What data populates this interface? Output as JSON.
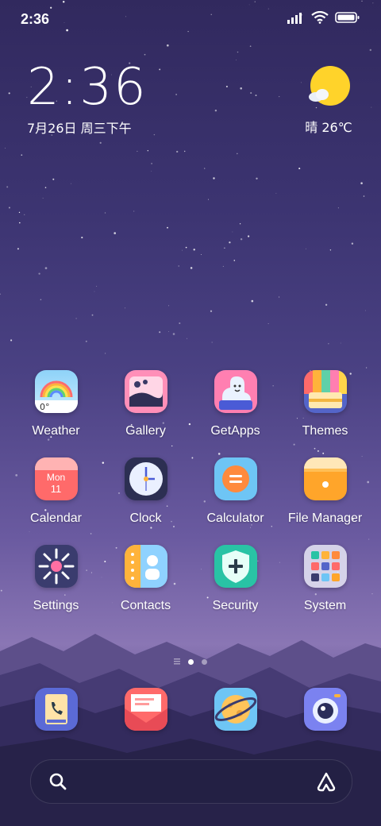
{
  "status_bar": {
    "time": "2:36"
  },
  "clock_widget": {
    "time": "2:36",
    "date": "7月26日 周三下午"
  },
  "weather_widget": {
    "temp": "晴 26℃"
  },
  "apps": [
    {
      "label": "Weather",
      "icon": "weather-icon"
    },
    {
      "label": "Gallery",
      "icon": "gallery-icon"
    },
    {
      "label": "GetApps",
      "icon": "getapps-icon"
    },
    {
      "label": "Themes",
      "icon": "themes-icon"
    },
    {
      "label": "Calendar",
      "icon": "calendar-icon",
      "day_name": "Mon",
      "day_num": "11"
    },
    {
      "label": "Clock",
      "icon": "clock-icon"
    },
    {
      "label": "Calculator",
      "icon": "calculator-icon"
    },
    {
      "label": "File Manager",
      "icon": "file-manager-icon"
    },
    {
      "label": "Settings",
      "icon": "settings-icon"
    },
    {
      "label": "Contacts",
      "icon": "contacts-icon"
    },
    {
      "label": "Security",
      "icon": "security-icon"
    },
    {
      "label": "System",
      "icon": "folder-icon"
    }
  ],
  "weather_icon_text": "0°",
  "dock": [
    {
      "icon": "phone-icon"
    },
    {
      "icon": "messages-icon"
    },
    {
      "icon": "browser-icon"
    },
    {
      "icon": "camera-icon"
    }
  ],
  "page_indicator": {
    "count": 2,
    "active": 0
  }
}
